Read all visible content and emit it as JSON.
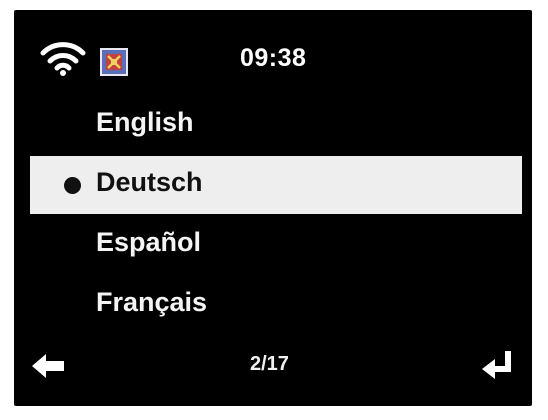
{
  "status": {
    "time": "09:38",
    "wifi_icon": "wifi-icon",
    "language_icon": "language-flag-icon"
  },
  "menu": {
    "items": [
      {
        "label": "English",
        "selected": false
      },
      {
        "label": "Deutsch",
        "selected": true
      },
      {
        "label": "Español",
        "selected": false
      },
      {
        "label": "Français",
        "selected": false
      }
    ]
  },
  "footer": {
    "page": "2/17",
    "back_icon": "back-arrow-icon",
    "enter_icon": "enter-icon"
  },
  "colors": {
    "screen_background": "#000000",
    "highlight_background": "#eeeeee",
    "text": "#ffffff",
    "selected_text": "#111111"
  }
}
